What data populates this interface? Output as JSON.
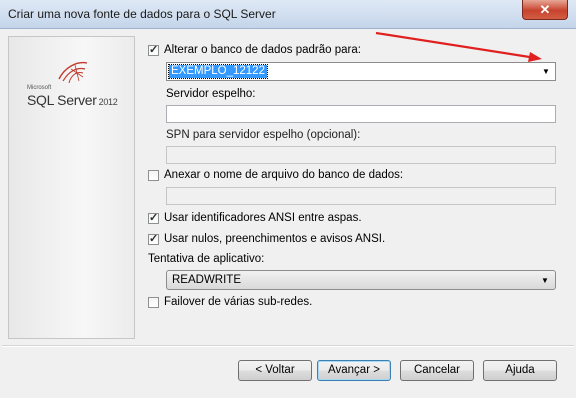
{
  "window": {
    "title": "Criar uma nova fonte de dados para o SQL Server",
    "close_symbol": "✕"
  },
  "logo": {
    "small": "Microsoft",
    "main": "SQL Server",
    "year": "2012"
  },
  "form": {
    "change_db": {
      "label": "Alterar o banco de dados padrão para:",
      "checked": true,
      "value": "EXEMPLO_12122"
    },
    "mirror_server": {
      "label": "Servidor espelho:",
      "value": ""
    },
    "mirror_spn": {
      "label": "SPN para servidor espelho (opcional):",
      "value": ""
    },
    "attach_db": {
      "label": "Anexar o nome de arquivo do banco de dados:",
      "checked": false,
      "value": ""
    },
    "ansi_quoted": {
      "label": "Usar identificadores ANSI entre aspas.",
      "checked": true
    },
    "ansi_nulls": {
      "label": "Usar nulos, preenchimentos e avisos ANSI.",
      "checked": true
    },
    "app_intent": {
      "label": "Tentativa de aplicativo:",
      "value": "READWRITE"
    },
    "multisubnet": {
      "label": "Failover de várias sub-redes.",
      "checked": false
    }
  },
  "buttons": {
    "back": "< Voltar",
    "next": "Avançar >",
    "cancel": "Cancelar",
    "help": "Ajuda"
  },
  "colors": {
    "annotation_arrow": "#e02020",
    "selection": "#3399ff"
  }
}
